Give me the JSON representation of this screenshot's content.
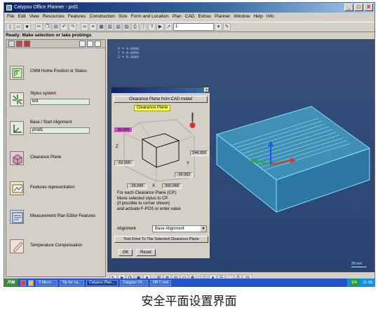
{
  "window": {
    "title": "Calypso Office Planner - prd1",
    "min": "_",
    "max": "□",
    "close": "X"
  },
  "menu": [
    "File",
    "Edit",
    "View",
    "Resources",
    "Features",
    "Construction",
    "Size",
    "Form and Location",
    "Plan",
    "CAD",
    "Extras",
    "Planner",
    "Window",
    "Help",
    "Info"
  ],
  "toolbar": {
    "combo_value": "1"
  },
  "status": "Ready: Make selection or take probings",
  "left_panel": {
    "items": [
      {
        "label": "CMM Home Position or Status",
        "field": null
      },
      {
        "label": "Stylus system",
        "field": "krd"
      },
      {
        "label": "Base / Start Alignment",
        "field": "prod1"
      },
      {
        "label": "Clearance Plane",
        "field": null
      },
      {
        "label": "Features representation",
        "field": null
      },
      {
        "label": "Measurement Plan Editor Features",
        "field": null
      },
      {
        "label": "Temperature Compensation",
        "field": null
      }
    ]
  },
  "viewport": {
    "coords": [
      "X =  0.0000",
      "Y =  0.0000",
      "Z =  0.0000"
    ],
    "scale": "30 mm"
  },
  "dialog": {
    "header_button": "Clearance Plane from CAD model",
    "title_label": "Clearance Plane",
    "values": {
      "top": "39.999",
      "right": "244.059",
      "left": "-62.000",
      "right_low": "-29.952",
      "bottom_left": "-29.999",
      "bottom_right": "300.048"
    },
    "axis": {
      "z": "Z",
      "y": "Y",
      "x": "X"
    },
    "instructions": [
      "For each Clearance Plane (CP):",
      "Move selected stylus to CP",
      "(if possible to corner shown)",
      "and activate F-POS or enter value"
    ],
    "alignment_label": "Alignment",
    "alignment_value": "Base Alignment",
    "test_button": "Test Drive To The Selected Clearance Plane",
    "ok": "OK",
    "reset": "Reset"
  },
  "taskbar": {
    "start": "开始",
    "tasks": [
      "3 Micro...",
      "Tip for ca...",
      "Calypso Plan...",
      "Calypso Of...",
      "Off 1 rest"
    ],
    "tray_lang": "EN",
    "time": "21:39"
  },
  "caption": "安全平面设置界面"
}
